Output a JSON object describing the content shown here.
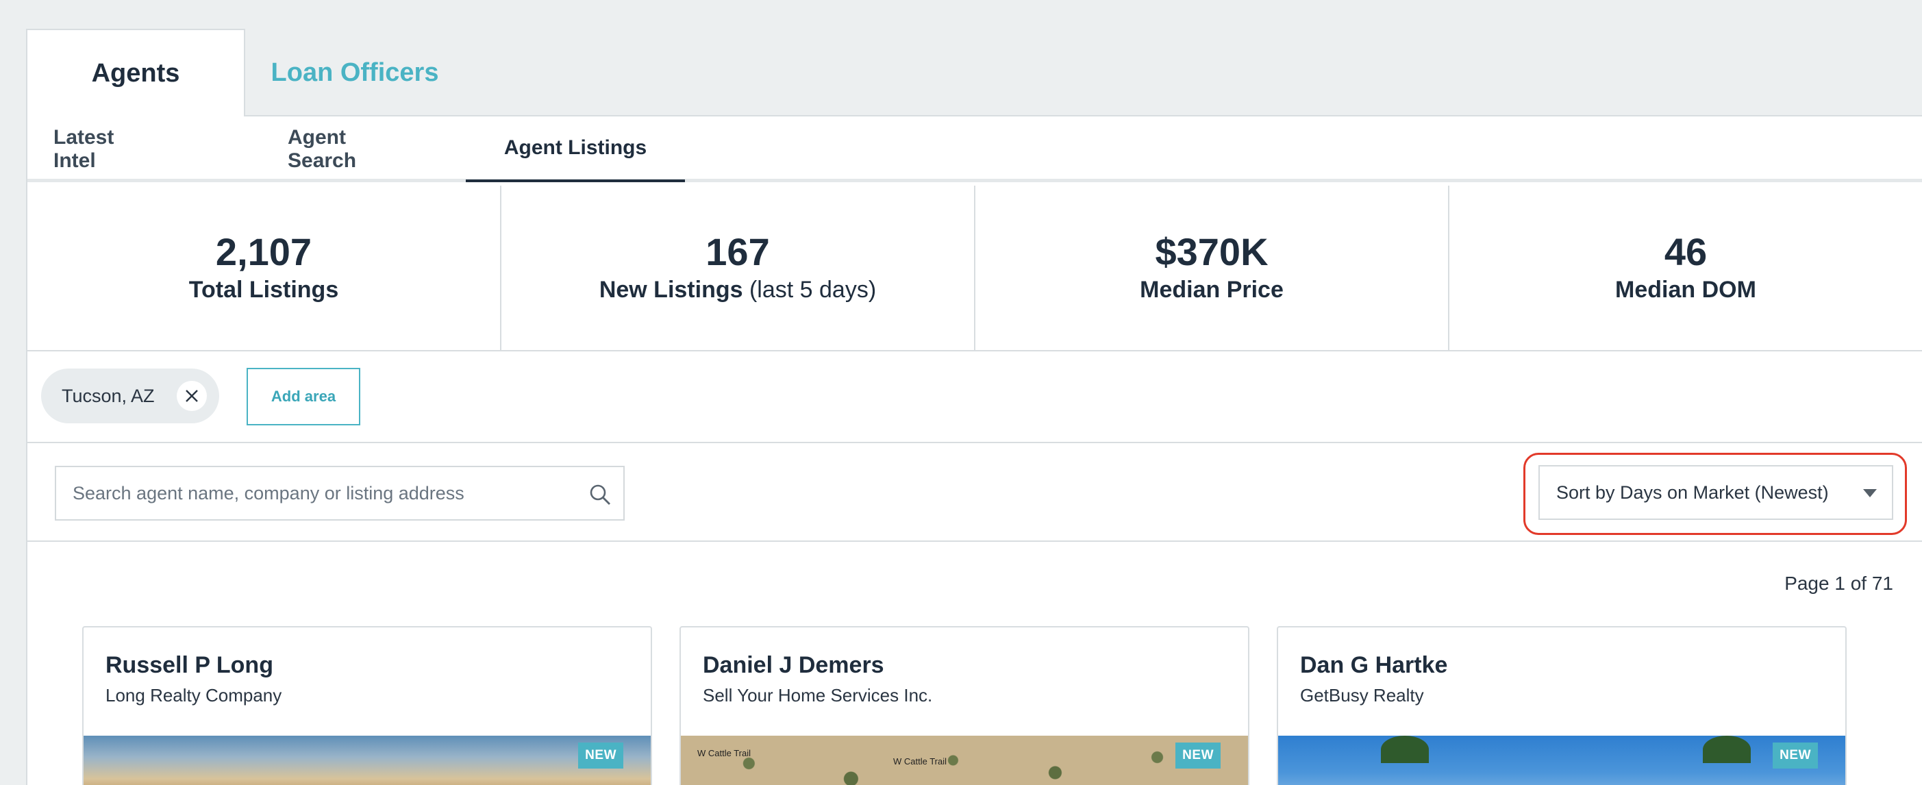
{
  "top_tabs": [
    {
      "label": "Agents",
      "active": true
    },
    {
      "label": "Loan Officers",
      "active": false
    }
  ],
  "sub_tabs": [
    {
      "label": "Latest Intel",
      "active": false
    },
    {
      "label": "Agent Search",
      "active": false
    },
    {
      "label": "Agent Listings",
      "active": true
    }
  ],
  "stats": [
    {
      "value": "2,107",
      "label": "Total Listings",
      "suffix": ""
    },
    {
      "value": "167",
      "label": "New Listings",
      "suffix": " (last 5 days)"
    },
    {
      "value": "$370K",
      "label": "Median Price",
      "suffix": ""
    },
    {
      "value": "46",
      "label": "Median DOM",
      "suffix": ""
    }
  ],
  "areas": {
    "chips": [
      {
        "label": "Tucson, AZ"
      }
    ],
    "add_label": "Add area"
  },
  "search": {
    "placeholder": "Search agent name, company or listing address",
    "value": ""
  },
  "sort": {
    "selected": "Sort by Days on Market (Newest)"
  },
  "pagination": {
    "text": "Page 1 of 71"
  },
  "cards": [
    {
      "name": "Russell P Long",
      "company": "Long Realty Company",
      "badge": "NEW"
    },
    {
      "name": "Daniel J Demers",
      "company": "Sell Your Home Services Inc.",
      "badge": "NEW",
      "map_labels": [
        "W Cattle Trail",
        "W Cattle Trail"
      ]
    },
    {
      "name": "Dan G Hartke",
      "company": "GetBusy Realty",
      "badge": "NEW"
    }
  ],
  "colors": {
    "accent": "#4ab3c4",
    "highlight": "#e23a2a",
    "text": "#1f2d3d"
  }
}
